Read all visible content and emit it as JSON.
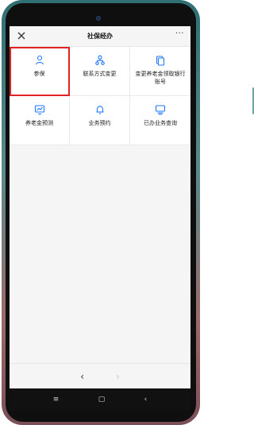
{
  "header": {
    "title": "社保经办",
    "more_glyph": "···",
    "close_icon": "close-icon"
  },
  "grid": {
    "items": [
      {
        "label": "参保",
        "icon": "user-icon",
        "selected": true
      },
      {
        "label": "联系方式变更",
        "icon": "org-tree-icon",
        "selected": false
      },
      {
        "label": "变更养老金领取银行账号",
        "icon": "documents-icon",
        "selected": false
      },
      {
        "label": "养老金预测",
        "icon": "chart-monitor-icon",
        "selected": false
      },
      {
        "label": "业务预约",
        "icon": "bell-icon",
        "selected": false
      },
      {
        "label": "已办业务查询",
        "icon": "monitor-list-icon",
        "selected": false
      }
    ]
  },
  "navbar": {
    "back_glyph": "‹",
    "forward_glyph": "›"
  },
  "system_nav": {
    "menu_glyph": "≡",
    "home_glyph": "▢",
    "back_glyph": "‹"
  },
  "colors": {
    "accent": "#1f78ff",
    "highlight": "#e12222"
  }
}
